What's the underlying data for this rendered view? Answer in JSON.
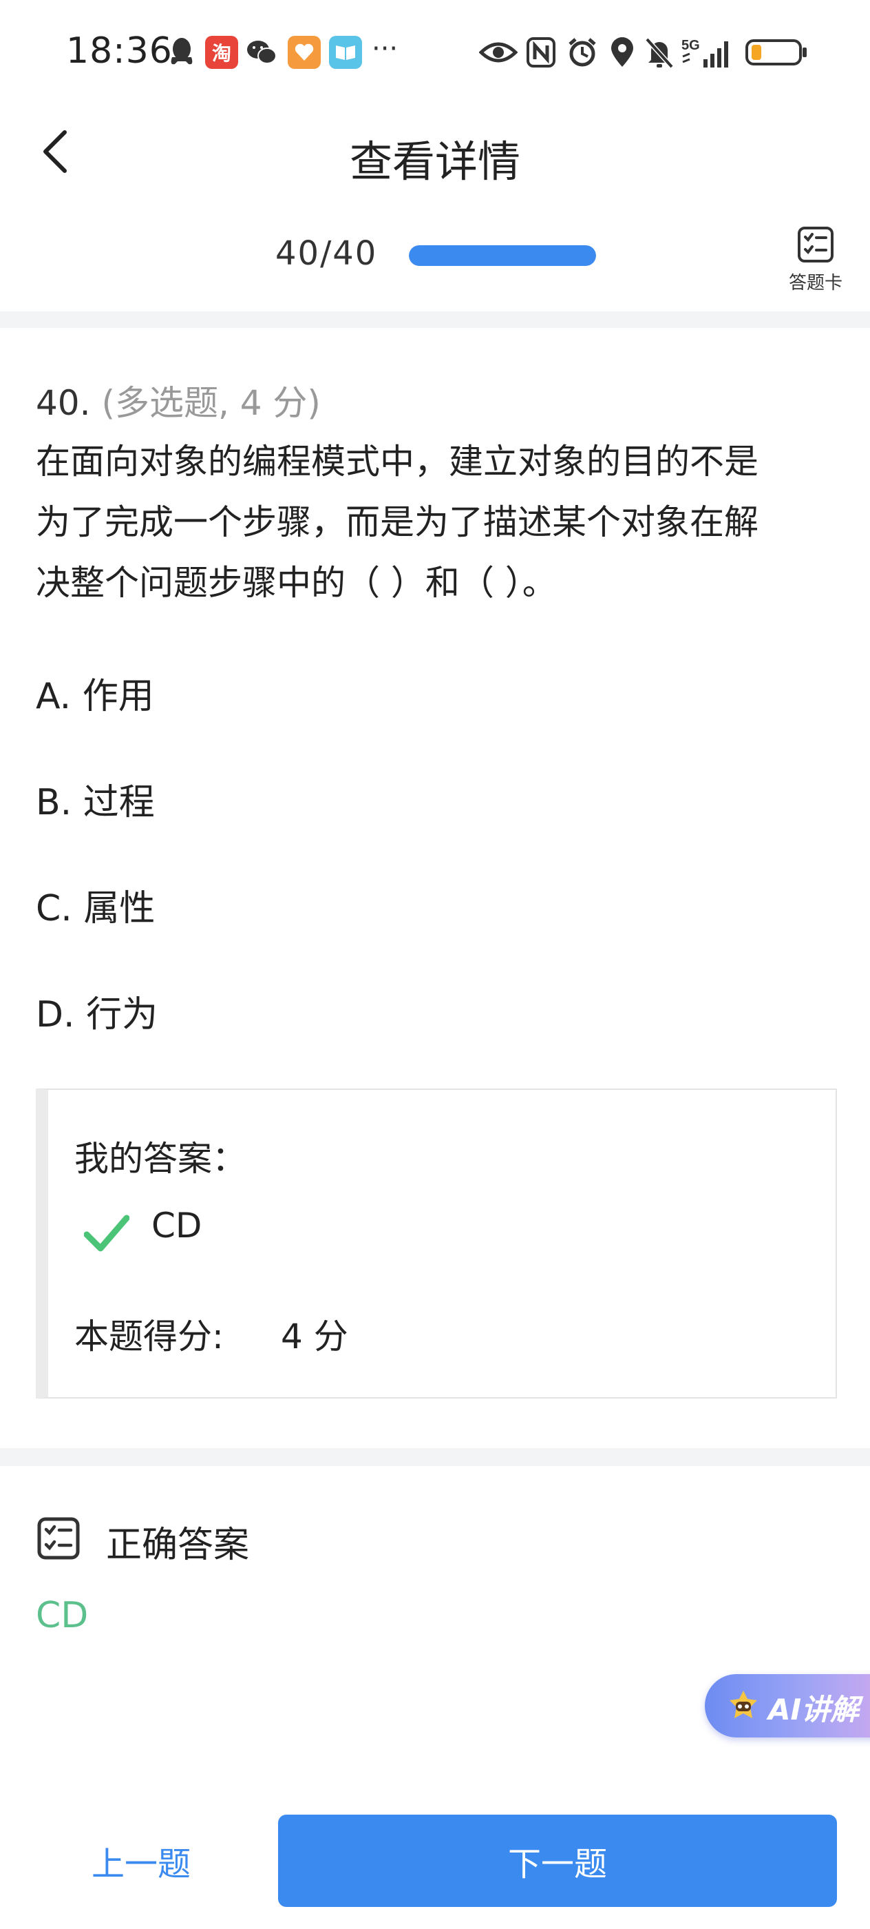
{
  "status_bar": {
    "time": "18:36",
    "overflow": "···",
    "network": "5G",
    "left_icons": [
      "qq-icon",
      "taobao-icon",
      "wechat-icon",
      "health-app-icon",
      "reader-app-icon"
    ],
    "right_icons": [
      "eye-icon",
      "nfc-icon",
      "alarm-icon",
      "location-icon",
      "mute-icon",
      "signal-icon",
      "battery-icon"
    ]
  },
  "header": {
    "title": "查看详情"
  },
  "progress": {
    "count": "40/40",
    "fraction": 1.0,
    "answer_card_label": "答题卡"
  },
  "question": {
    "number": "40.",
    "type": "(多选题, 4 分)",
    "line1": "在面向对象的编程模式中，建立对象的目的不是",
    "line2": "为了完成一个步骤，而是为了描述某个对象在解",
    "line3": "决整个问题步骤中的（    ）和（    ）。",
    "options": [
      {
        "label": "A. 作用"
      },
      {
        "label": "B. 过程"
      },
      {
        "label": "C. 属性"
      },
      {
        "label": "D. 行为"
      }
    ]
  },
  "my_answer": {
    "label": "我的答案：",
    "value": "CD",
    "score_label": "本题得分:",
    "score_value": "4 分"
  },
  "correct_answer": {
    "title": "正确答案",
    "value": "CD"
  },
  "ai": {
    "label": "AI讲解"
  },
  "nav": {
    "prev": "上一题",
    "next": "下一题"
  },
  "colors": {
    "accent": "#3b8af0",
    "correct": "#5cc08c",
    "check": "#4cc477"
  }
}
